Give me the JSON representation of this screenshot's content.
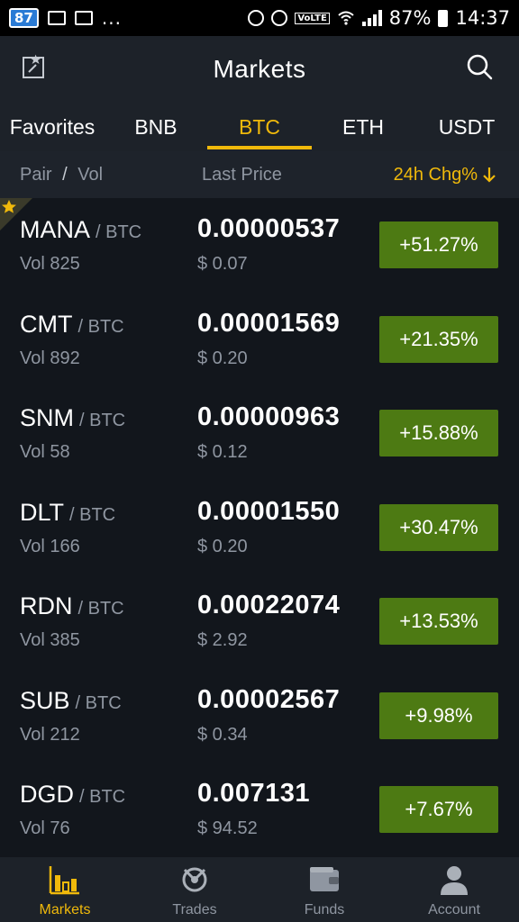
{
  "status_bar": {
    "notification_count": "87",
    "more": "...",
    "volte": "VoLTE",
    "battery": "87%",
    "time": "14:37"
  },
  "header": {
    "title": "Markets",
    "left_icon": "edit-favorites-icon",
    "right_icon": "search-icon"
  },
  "tabs": [
    {
      "label": "Favorites"
    },
    {
      "label": "BNB"
    },
    {
      "label": "BTC",
      "active": true
    },
    {
      "label": "ETH"
    },
    {
      "label": "USDT"
    }
  ],
  "columns": {
    "pair": "Pair",
    "slash": "/",
    "vol": "Vol",
    "last_price": "Last Price",
    "change": "24h Chg%"
  },
  "rows": [
    {
      "base": "MANA",
      "quote": "/ BTC",
      "vol": "Vol 825",
      "price": "0.00000537",
      "usd": "$ 0.07",
      "change": "+51.27%",
      "favorite": true
    },
    {
      "base": "CMT",
      "quote": "/ BTC",
      "vol": "Vol 892",
      "price": "0.00001569",
      "usd": "$ 0.20",
      "change": "+21.35%"
    },
    {
      "base": "SNM",
      "quote": "/ BTC",
      "vol": "Vol 58",
      "price": "0.00000963",
      "usd": "$ 0.12",
      "change": "+15.88%"
    },
    {
      "base": "DLT",
      "quote": "/ BTC",
      "vol": "Vol 166",
      "price": "0.00001550",
      "usd": "$ 0.20",
      "change": "+30.47%"
    },
    {
      "base": "RDN",
      "quote": "/ BTC",
      "vol": "Vol 385",
      "price": "0.00022074",
      "usd": "$ 2.92",
      "change": "+13.53%"
    },
    {
      "base": "SUB",
      "quote": "/ BTC",
      "vol": "Vol 212",
      "price": "0.00002567",
      "usd": "$ 0.34",
      "change": "+9.98%"
    },
    {
      "base": "DGD",
      "quote": "/ BTC",
      "vol": "Vol 76",
      "price": "0.007131",
      "usd": "$ 94.52",
      "change": "+7.67%"
    }
  ],
  "bottom_nav": [
    {
      "label": "Markets",
      "icon": "markets-chart-icon",
      "active": true
    },
    {
      "label": "Trades",
      "icon": "trades-icon"
    },
    {
      "label": "Funds",
      "icon": "wallet-icon"
    },
    {
      "label": "Account",
      "icon": "account-icon"
    }
  ],
  "colors": {
    "accent": "#f0b90b",
    "positive_badge": "#4d7a13",
    "background": "#12161c",
    "muted_text": "#8f96a1"
  }
}
